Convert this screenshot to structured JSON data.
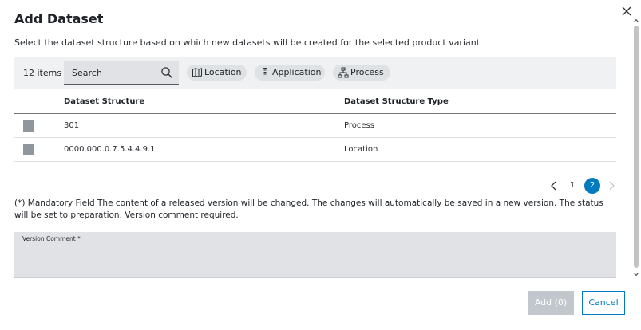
{
  "dialog": {
    "title": "Add Dataset",
    "subtitle": "Select the dataset structure based on which new datasets will be created for the selected product variant"
  },
  "toolbar": {
    "item_count": "12 items",
    "search": {
      "placeholder": "Search",
      "value": ""
    },
    "filters": [
      {
        "label": "Location",
        "icon": "map-icon"
      },
      {
        "label": "Application",
        "icon": "device-icon"
      },
      {
        "label": "Process",
        "icon": "hierarchy-icon"
      }
    ]
  },
  "table": {
    "columns": [
      "Dataset Structure",
      "Dataset Structure Type"
    ],
    "rows": [
      {
        "structure": "301",
        "type": "Process",
        "checked": false
      },
      {
        "structure": "0000.000.0.7.5.4.4.9.1",
        "type": "Location",
        "checked": false
      }
    ]
  },
  "pagination": {
    "pages": [
      "1",
      "2"
    ],
    "current": "2"
  },
  "note": "(*) Mandatory Field The content of a released version will be changed.  The changes will automatically be saved in a new version.  The status will be set to preparation. Version comment required.",
  "version_comment": {
    "label": "Version Comment *",
    "value": ""
  },
  "footer": {
    "add_label": "Add (0)",
    "cancel_label": "Cancel"
  },
  "colors": {
    "accent": "#007bc0",
    "toolbar_bg": "#eff1f2",
    "field_bg": "#e0e2e5",
    "disabled_button": "#c1c7cc",
    "checkbox": "#8f969c"
  }
}
